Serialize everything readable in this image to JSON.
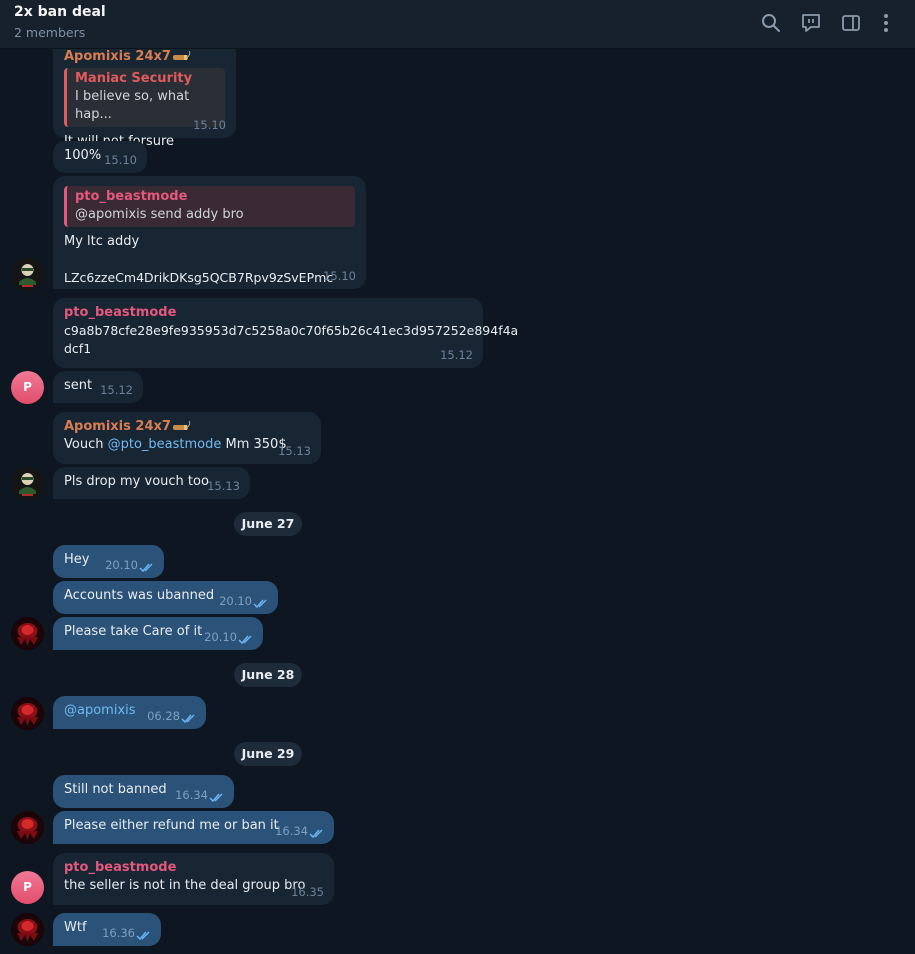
{
  "header": {
    "title": "2x ban deal",
    "subtitle": "2 members",
    "icons": [
      "search-icon",
      "video-chat-icon",
      "sidebar-toggle-icon",
      "more-icon"
    ]
  },
  "avatars": {
    "p_letter": "P"
  },
  "messages": [
    {
      "sender": "Apomixis 24x7",
      "reply_name": "Maniac Security",
      "reply_text": "I believe so, what hap...",
      "text": "It will not forsure",
      "time": "15.10"
    },
    {
      "text": "100%",
      "time": "15.10"
    },
    {
      "reply_name": "pto_beastmode",
      "reply_text": "@apomixis send addy bro",
      "line1": "My ltc addy",
      "line2": "LZc6zzeCm4DrikDKsg5QCB7Rpv9zSvEPmc",
      "time": "15.10"
    },
    {
      "sender": "pto_beastmode",
      "line1": "c9a8b78cfe28e9fe935953d7c5258a0c70f65b26c41ec3d957252e894f4a",
      "line2": "dcf1",
      "time": "15.12"
    },
    {
      "text": "sent",
      "time": "15.12"
    },
    {
      "sender": "Apomixis 24x7",
      "text_pre": "Vouch ",
      "mention": "@pto_beastmode",
      "text_post": " Mm 350$",
      "time": "15.13"
    },
    {
      "text": "Pls drop my vouch too",
      "time": "15.13"
    },
    {
      "text": "Hey",
      "time": "20.10"
    },
    {
      "text": "Accounts was ubanned",
      "time": "20.10"
    },
    {
      "text": "Please take Care of it",
      "time": "20.10"
    },
    {
      "mention": "@apomixis",
      "time": "06.28"
    },
    {
      "text": "Still not banned",
      "time": "16.34"
    },
    {
      "text": "Please either refund me or ban it",
      "time": "16.34"
    },
    {
      "sender": "pto_beastmode",
      "text": "the seller is not in the deal group bro",
      "time": "16.35"
    },
    {
      "text": "Wtf",
      "time": "16.36"
    }
  ],
  "dates": [
    "June 27",
    "June 28",
    "June 29"
  ],
  "colors": {
    "background": "#0e1621",
    "header": "#17212b",
    "incoming_bubble": "#182533",
    "outgoing_bubble": "#2b5278",
    "sender_orange": "#d97d53",
    "sender_pink": "#e4597d",
    "link": "#71baf2"
  }
}
